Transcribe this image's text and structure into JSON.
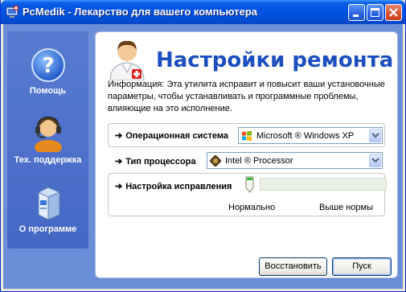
{
  "window": {
    "title": "PcMedik - Лекарство для вашего компьютера"
  },
  "sidebar": {
    "items": [
      {
        "label": "Помощь",
        "icon": "help-icon"
      },
      {
        "label": "Тех. поддержка",
        "icon": "support-headset-icon"
      },
      {
        "label": "О программе",
        "icon": "about-box-icon"
      }
    ]
  },
  "main": {
    "title": "Настройки ремонта",
    "info": "Информация: Эта утилита исправит и повысит ваши установочные параметры, чтобы устанавливать и программные проблемы, влияющие на это исполнение.",
    "os": {
      "label": "Операционная система",
      "value": "Microsoft ® Windows XP",
      "icon": "windows-logo-icon"
    },
    "cpu": {
      "label": "Тип процессора",
      "value": "Intel ® Processor",
      "icon": "cpu-chip-icon"
    },
    "fix": {
      "label": "Настройка исправления",
      "level": 0,
      "min_label": "Нормально",
      "max_label": "Выше нормы"
    }
  },
  "buttons": {
    "restore": "Восстановить",
    "start": "Пуск"
  },
  "colors": {
    "title_blue": "#1b4fbf",
    "sidebar_blue": "#4f72cc",
    "titlebar_blue": "#0054e3"
  }
}
